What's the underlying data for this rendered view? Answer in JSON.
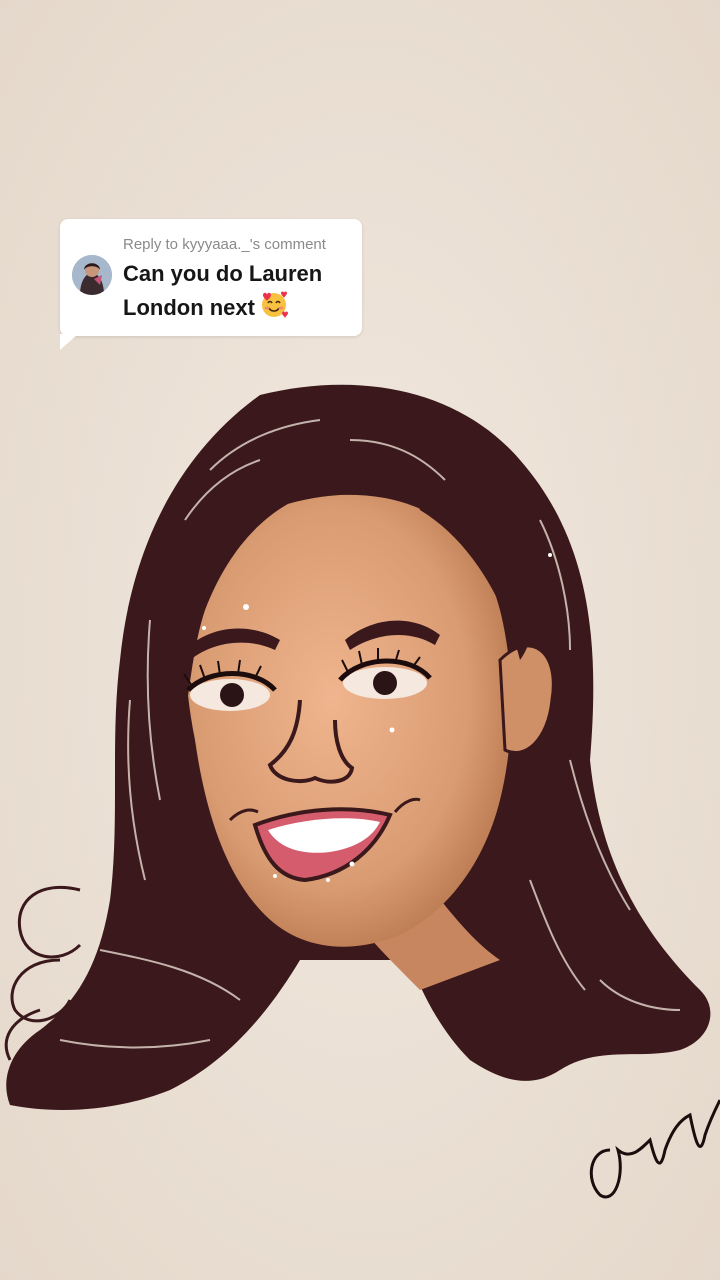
{
  "reply": {
    "header": "Reply to kyyyaaa._'s comment",
    "text": "Can you do Lauren London next",
    "emoji": "smiling-face-with-hearts"
  },
  "colors": {
    "paper": "#ece1d6",
    "hair": "#3b1a1d",
    "skin": "#d9a07c",
    "lips": "#d25a6a",
    "bubble": "#ffffff"
  }
}
